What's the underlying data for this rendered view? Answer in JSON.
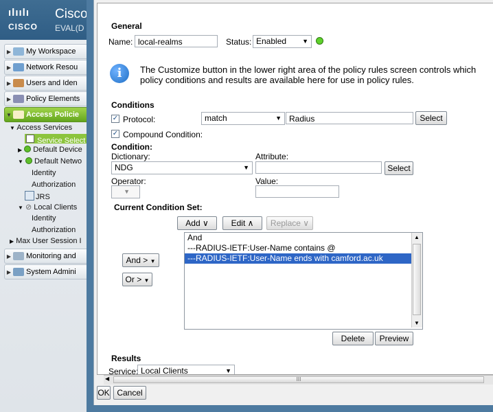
{
  "brand": {
    "logo_bars": "ılıılı",
    "logo_word": "CISCO",
    "product": "Cisco",
    "edition": "EVAL(D"
  },
  "nav": {
    "items": [
      "My Workspace",
      "Network Resou",
      "Users and Iden",
      "Policy Elements",
      "Access Policie",
      "Monitoring and",
      "System Admini"
    ],
    "tree": {
      "access_services": "Access Services",
      "service_select": "Service Select",
      "default_device": "Default Device",
      "default_network": "Default Netwo",
      "identity": "Identity",
      "authorization": "Authorization",
      "jrs": "JRS",
      "local_clients": "Local Clients",
      "identity2": "Identity",
      "authorization2": "Authorization",
      "max_user_session": "Max User Session I"
    }
  },
  "general": {
    "heading": "General",
    "name_label": "Name:",
    "name_value": "local-realms",
    "status_label": "Status:",
    "status_value": "Enabled"
  },
  "info": {
    "line1": "The Customize button in the lower right area of the policy rules screen controls which",
    "line2": "policy conditions and results are available here for use in policy rules."
  },
  "conditions": {
    "heading": "Conditions",
    "protocol_label": "Protocol:",
    "protocol_operator": "match",
    "protocol_value": "Radius",
    "select_label": "Select",
    "compound_label": "Compound Condition:",
    "condition_heading": "Condition:",
    "dictionary_label": "Dictionary:",
    "dictionary_value": "NDG",
    "attribute_label": "Attribute:",
    "attribute_value": "",
    "attribute_select": "Select",
    "operator_label": "Operator:",
    "value_label": "Value:",
    "current_set_heading": "Current Condition Set:",
    "add_label": "Add ∨",
    "edit_label": "Edit ∧",
    "replace_label": "Replace ∨",
    "and_label": "And >",
    "or_label": "Or >",
    "set_rows": [
      "And",
      "---RADIUS-IETF:User-Name contains @",
      "---RADIUS-IETF:User-Name ends with camford.ac.uk"
    ],
    "selected_row": 2,
    "delete_label": "Delete",
    "preview_label": "Preview"
  },
  "results": {
    "heading": "Results",
    "service_label": "Service:",
    "service_value": "Local Clients"
  },
  "footer": {
    "ok_label": "OK",
    "cancel_label": "Cancel",
    "scroll_grip": "III"
  },
  "colors": {
    "accent_green": "#8cc43d",
    "selection_blue": "#2e66c6",
    "info_icon": "#1f6fc5"
  }
}
